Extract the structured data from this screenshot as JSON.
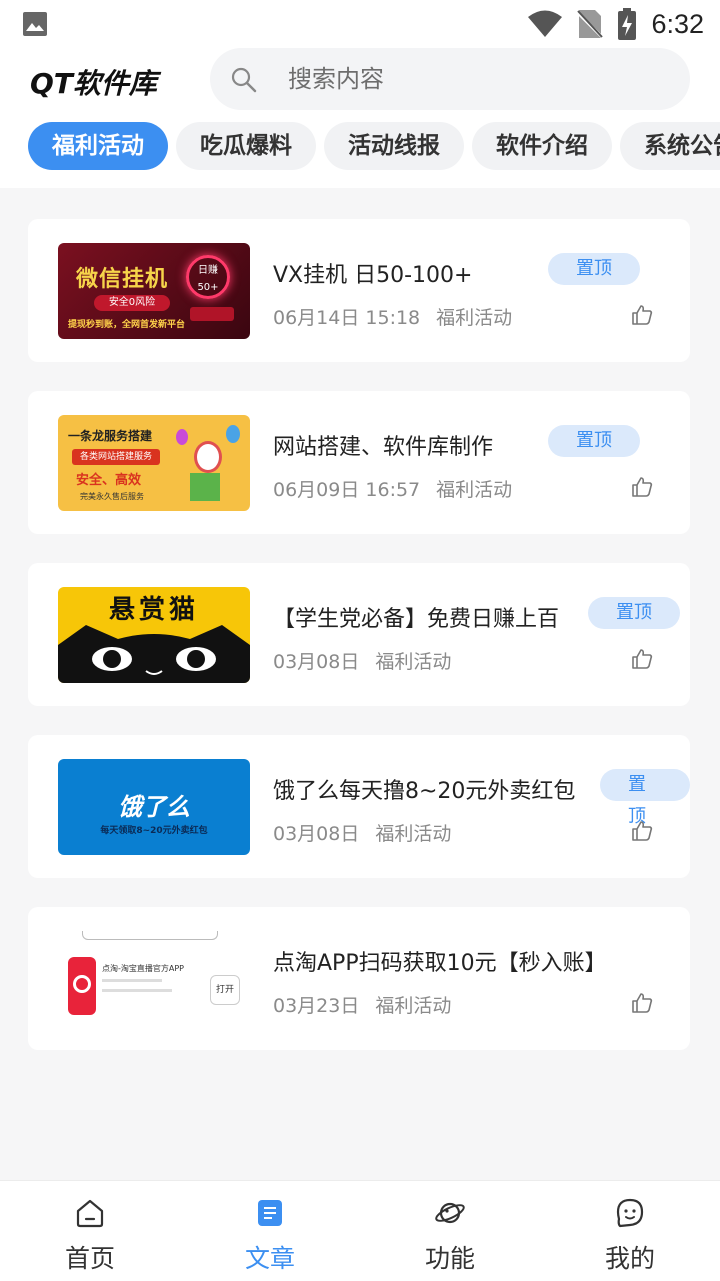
{
  "status_bar": {
    "time": "6:32"
  },
  "header": {
    "app_title": "QT软件库",
    "search_placeholder": "搜索内容"
  },
  "tabs": [
    {
      "label": "福利活动",
      "active": true
    },
    {
      "label": "吃瓜爆料",
      "active": false
    },
    {
      "label": "活动线报",
      "active": false
    },
    {
      "label": "软件介绍",
      "active": false
    },
    {
      "label": "系统公告",
      "active": false
    }
  ],
  "articles": [
    {
      "title": "VX挂机 日50-100+",
      "date": "06月14日  15:18",
      "category": "福利活动",
      "pin_label": "置顶",
      "thumb": {
        "headline": "微信挂机",
        "sub": "安全0风险",
        "footer": "提现秒到账，全网首发新平台",
        "badge_top": "日赚",
        "badge_bottom": "50+"
      }
    },
    {
      "title": "网站搭建、软件库制作",
      "date": "06月09日  16:57",
      "category": "福利活动",
      "pin_label": "置顶",
      "thumb": {
        "headline": "一条龙服务搭建",
        "sub": "各类网站搭建服务",
        "line3": "安全、高效",
        "footer": "完美永久售后服务"
      }
    },
    {
      "title": "【学生党必备】免费日赚上百",
      "date": "03月08日",
      "category": "福利活动",
      "pin_label": "置顶",
      "thumb": {
        "headline": "悬赏猫"
      }
    },
    {
      "title": "饿了么每天撸8~20元外卖红包",
      "date": "03月08日",
      "category": "福利活动",
      "pin_label": "置顶",
      "thumb": {
        "headline": "饿了么",
        "footer": "每天领取8~20元外卖红包"
      }
    },
    {
      "title": "点淘APP扫码获取10元【秒入账】",
      "date": "03月23日",
      "category": "福利活动",
      "pin_label": "",
      "thumb": {
        "headline": "点淘-淘宝直播官方APP",
        "button": "打开"
      }
    }
  ],
  "bottom_nav": [
    {
      "label": "首页",
      "icon": "home-icon",
      "active": false
    },
    {
      "label": "文章",
      "icon": "article-icon",
      "active": true
    },
    {
      "label": "功能",
      "icon": "planet-icon",
      "active": false
    },
    {
      "label": "我的",
      "icon": "profile-icon",
      "active": false
    }
  ],
  "colors": {
    "accent": "#3c8ff1",
    "pin_bg": "#dbe9fb",
    "page_bg": "#f6f6f7"
  }
}
